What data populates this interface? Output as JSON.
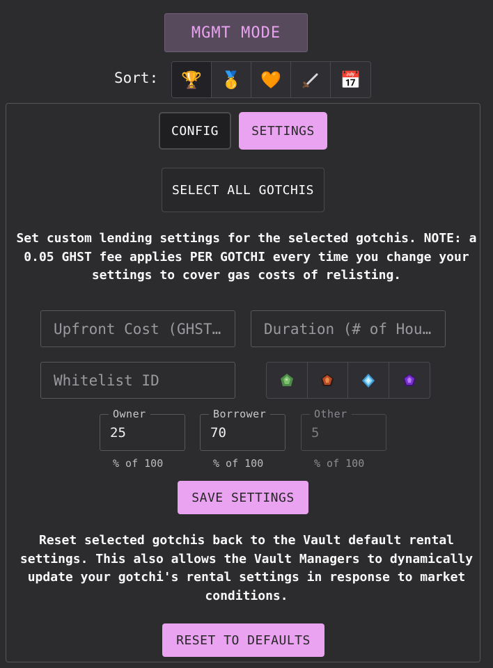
{
  "header": {
    "mode_label": "MGMT MODE"
  },
  "sort": {
    "label": "Sort:",
    "options": [
      {
        "icon": "trophy-icon",
        "glyph": "🏆",
        "active": true
      },
      {
        "icon": "medal-icon",
        "glyph": "🥇",
        "active": false
      },
      {
        "icon": "heart-icon",
        "glyph": "🧡",
        "active": false
      },
      {
        "icon": "sword-icon",
        "glyph": "🗡",
        "active": false
      },
      {
        "icon": "calendar-icon",
        "glyph": "📅",
        "active": false
      }
    ]
  },
  "tabs": {
    "config": "CONFIG",
    "settings": "SETTINGS",
    "active": "settings"
  },
  "select_all_label": "SELECT ALL GOTCHIS",
  "intro_text": "Set custom lending settings for the selected gotchis. NOTE: a 0.05 GHST fee applies PER GOTCHI every time you change your settings to cover gas costs of relisting.",
  "fields": {
    "upfront_placeholder": "Upfront Cost (GHST…",
    "duration_placeholder": "Duration (# of Hou…",
    "whitelist_placeholder": "Whitelist ID"
  },
  "channels": [
    {
      "icon": "green-gem-icon",
      "color": "#5fa35a"
    },
    {
      "icon": "orange-gem-icon",
      "color": "#c9572c"
    },
    {
      "icon": "blue-gem-icon",
      "color": "#6fc8f0"
    },
    {
      "icon": "purple-gem-icon",
      "color": "#8a3ad6"
    }
  ],
  "split": {
    "owner": {
      "label": "Owner",
      "value": "25",
      "help": "% of 100"
    },
    "borrower": {
      "label": "Borrower",
      "value": "70",
      "help": "% of 100"
    },
    "other": {
      "label": "Other",
      "value": "5",
      "help": "% of 100"
    }
  },
  "save_label": "SAVE SETTINGS",
  "reset_text": "Reset selected gotchis back to the Vault default rental settings. This also allows the Vault Managers to dynamically update your gotchi's rental settings in response to market conditions.",
  "reset_label": "RESET TO DEFAULTS",
  "colors": {
    "accent": "#e9a3f0",
    "background": "#2c2c2f"
  }
}
